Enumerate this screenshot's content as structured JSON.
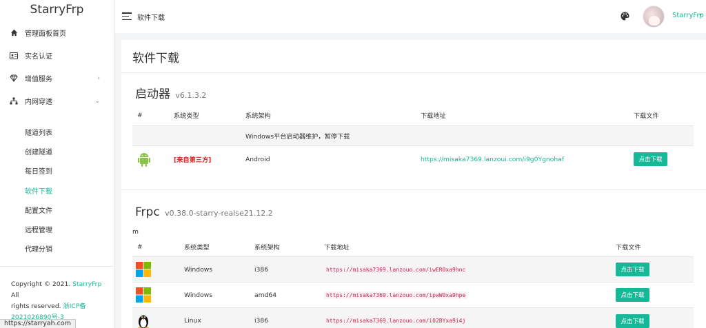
{
  "sidebar": {
    "brand": "StarryFrp",
    "items": [
      {
        "label": "管理面板首页",
        "icon": "home-icon"
      },
      {
        "label": "实名认证",
        "icon": "id-card-icon"
      },
      {
        "label": "增值服务",
        "icon": "diamond-icon",
        "chevron": "›"
      },
      {
        "label": "内网穿透",
        "icon": "sitemap-icon",
        "chevron": "⌄"
      }
    ],
    "subitems": [
      "隧道列表",
      "创建隧道",
      "每日签到",
      "软件下载",
      "配置文件",
      "远程管理",
      "代理分销"
    ],
    "active_subitem": "软件下载",
    "footer": {
      "copyright_prefix": "Copyright © 2021.",
      "brand_link": "StarryFrp",
      "all": "All",
      "rights": "rights reserved.",
      "icp": "浙ICP备",
      "icp_number": "2021026890号-3"
    }
  },
  "status_url": "https://starryah.com",
  "header": {
    "page_title": "软件下载",
    "user_name": "StarryFrp",
    "user_caret": "▾"
  },
  "card": {
    "title": "软件下载",
    "launcher": {
      "title": "启动器",
      "version": "v6.1.3.2",
      "columns": [
        "#",
        "系统类型",
        "系统架构",
        "下载地址",
        "下载文件"
      ],
      "notice": "Windows平台启动器维护，暂停下载",
      "rows": [
        {
          "icon": "android-icon",
          "type": "[来自第三方]",
          "arch": "Android",
          "url": "https://misaka7369.lanzoui.com/i9g0Ygnohaf",
          "button": "点击下载"
        }
      ]
    },
    "frpc": {
      "title": "Frpc",
      "version": "v0.38.0-starry-realse21.12.2",
      "stray": "m",
      "columns": [
        "#",
        "系统类型",
        "系统架构",
        "下载地址",
        "下载文件"
      ],
      "rows": [
        {
          "icon": "windows-icon",
          "type": "Windows",
          "arch": "i386",
          "url": "https://misaka7369.lanzouo.com/iwER0xa9hnc",
          "button": "点击下载"
        },
        {
          "icon": "windows-icon",
          "type": "Windows",
          "arch": "amd64",
          "url": "https://misaka7369.lanzouo.com/ipwW0xa9hpe",
          "button": "点击下载"
        },
        {
          "icon": "linux-icon",
          "type": "Linux",
          "arch": "i386",
          "url": "https://misaka7369.lanzouo.com/i02BYxa9i4j",
          "button": "点击下载"
        }
      ]
    }
  },
  "colors": {
    "accent": "#17b897",
    "danger": "#e02020",
    "code": "#c7254e"
  }
}
